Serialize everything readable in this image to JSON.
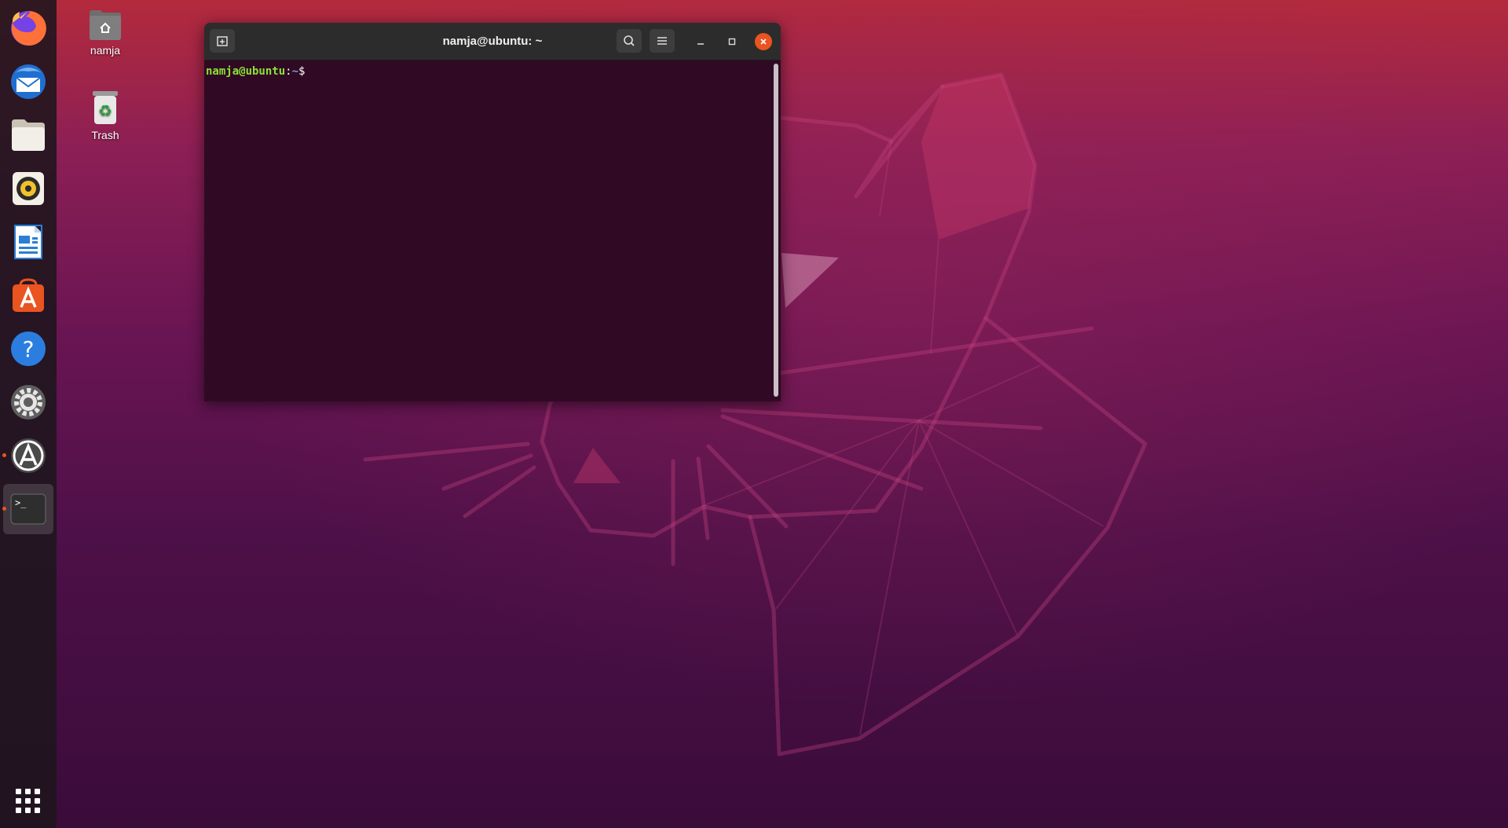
{
  "desktop": {
    "icons": [
      {
        "label": "namja",
        "icon": "home-folder-icon"
      },
      {
        "label": "Trash",
        "icon": "trash-icon"
      }
    ]
  },
  "dock": {
    "items": [
      {
        "name": "Firefox",
        "icon": "firefox-icon",
        "running": false
      },
      {
        "name": "Thunderbird",
        "icon": "thunderbird-icon",
        "running": false
      },
      {
        "name": "Files",
        "icon": "files-icon",
        "running": false
      },
      {
        "name": "Rhythmbox",
        "icon": "rhythmbox-icon",
        "running": false
      },
      {
        "name": "LibreOffice Writer",
        "icon": "writer-icon",
        "running": false
      },
      {
        "name": "Ubuntu Software",
        "icon": "software-icon",
        "running": false
      },
      {
        "name": "Help",
        "icon": "help-icon",
        "running": false
      },
      {
        "name": "Settings",
        "icon": "settings-icon",
        "running": false
      },
      {
        "name": "Software Updater",
        "icon": "updater-icon",
        "running": true
      },
      {
        "name": "Terminal",
        "icon": "terminal-icon",
        "running": true,
        "active": true
      }
    ],
    "show_apps_icon": "app-grid-icon"
  },
  "terminal": {
    "title": "namja@ubuntu: ~",
    "prompt": {
      "user_host": "namja@ubuntu",
      "separator": ":",
      "path": "~",
      "symbol": "$"
    },
    "buttons": {
      "new_tab_icon": "new-tab-icon",
      "search_icon": "search-icon",
      "menu_icon": "hamburger-menu-icon",
      "minimize_icon": "minimize-icon",
      "maximize_icon": "maximize-icon",
      "close_icon": "close-icon"
    }
  },
  "colors": {
    "accent": "#e95420",
    "terminal_bg": "#300a24",
    "prompt_user": "#8ae234",
    "prompt_path": "#729fcf"
  }
}
